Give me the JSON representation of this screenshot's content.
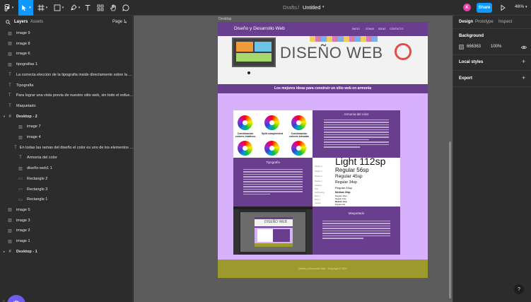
{
  "toolbar": {
    "breadcrumb": {
      "folder": "Drafts",
      "separator": "/",
      "file": "Untitled"
    },
    "avatar_initial": "K",
    "share_label": "Share",
    "zoom": "46%"
  },
  "left_panel": {
    "tabs": {
      "layers": "Layers",
      "assets": "Assets"
    },
    "page": "Page 1",
    "layers": [
      {
        "label": "image 9",
        "icon": "image-icon",
        "indent": 0
      },
      {
        "label": "image 8",
        "icon": "image-icon",
        "indent": 0
      },
      {
        "label": "image 6",
        "icon": "image-icon",
        "indent": 0
      },
      {
        "label": "tipografias 1",
        "icon": "image-icon",
        "indent": 0
      },
      {
        "label": "La correcta eleccion de la tipografia inside directamente sobre la ...",
        "icon": "text-icon",
        "indent": 0
      },
      {
        "label": "Tipografia",
        "icon": "text-icon",
        "indent": 0
      },
      {
        "label": "Para lograr una vista previa de nuestro sitio web, sin todo el esfue...",
        "icon": "text-icon",
        "indent": 0
      },
      {
        "label": "Maquetado",
        "icon": "text-icon",
        "indent": 0
      },
      {
        "label": "Desktop - 2",
        "icon": "frame-icon",
        "indent": 0,
        "frame": true,
        "expanded": true
      },
      {
        "label": "image 7",
        "icon": "image-icon",
        "indent": 1
      },
      {
        "label": "image 4",
        "icon": "image-icon",
        "indent": 1
      },
      {
        "label": "En todas las ramas del diseño el color es uno de los elementos ...",
        "icon": "text-icon",
        "indent": 1
      },
      {
        "label": "Armonia del color",
        "icon": "text-icon",
        "indent": 1
      },
      {
        "label": "diseño-web1 1",
        "icon": "image-icon",
        "indent": 1
      },
      {
        "label": "Rectangle 2",
        "icon": "rectangle-icon",
        "indent": 1
      },
      {
        "label": "Rectangle 3",
        "icon": "rectangle-icon",
        "indent": 1
      },
      {
        "label": "Rectangle 1",
        "icon": "rectangle-icon",
        "indent": 1
      },
      {
        "label": "image 5",
        "icon": "image-icon",
        "indent": 0
      },
      {
        "label": "image 3",
        "icon": "image-icon",
        "indent": 0
      },
      {
        "label": "image 2",
        "icon": "image-icon",
        "indent": 0
      },
      {
        "label": "image 1",
        "icon": "image-icon",
        "indent": 0
      },
      {
        "label": "Desktop - 1",
        "icon": "frame-icon",
        "indent": 0,
        "frame": true,
        "expanded": false
      }
    ]
  },
  "canvas": {
    "frame_label": "Desktop",
    "design": {
      "logo": "Diseño y Desarrollo Web",
      "nav": [
        "INICIO",
        "ZONAS",
        "IDEAS",
        "CONTACTO"
      ],
      "hero_title": "DISEÑO WEB",
      "strip": "Los mejores ideas para construir un sitio web en armonia",
      "color_title": "Armonia del color",
      "wheels": [
        "Combinación colores triádicos",
        "Split complement",
        "Combinación colores tetradas"
      ],
      "typo_title": "Tipografia",
      "typo_samples": [
        "Light 112sp",
        "Regular 56sp",
        "Regular 45sp",
        "Regular 34sp",
        "Regular 24sp",
        "Medium 20sp",
        "Regular 16sp",
        "Regular 14sp",
        "Medium 14sp",
        "Regular 12sp"
      ],
      "typo_side": [
        "Display 4",
        "Display 3",
        "Display 2",
        "Display 1",
        "Headline",
        "Title",
        "Subheading",
        "Body 2",
        "Body 1",
        "Caption"
      ],
      "mini_title": "DISEÑO WEB",
      "maquetado_title": "Maquetado",
      "footer": "Diseño y Desarrollo Web · Copyright © 2021"
    }
  },
  "right_panel": {
    "tabs": {
      "design": "Design",
      "prototype": "Prototype",
      "inspect": "Inspect"
    },
    "background": {
      "label": "Background",
      "hex": "666363",
      "opacity": "100%"
    },
    "local_styles": "Local styles",
    "export": "Export"
  },
  "colors": {
    "accent": "#0d99ff",
    "avatar": "#e83ea6",
    "plugin": "#6e5cf0",
    "design_purple": "#6a3e8f",
    "design_lavender": "#d7b1fb",
    "design_olive": "#9c9a2c"
  }
}
